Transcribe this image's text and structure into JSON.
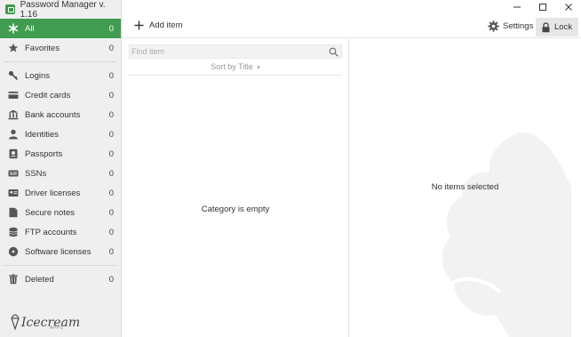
{
  "app": {
    "title": "Password Manager v. 1.16"
  },
  "window_controls": {
    "minimize": "—",
    "maximize": "☐",
    "close": "✕"
  },
  "sidebar": {
    "items": [
      {
        "key": "all",
        "label": "All",
        "count": "0",
        "icon": "asterisk-icon",
        "active": true
      },
      {
        "key": "favorites",
        "label": "Favorites",
        "count": "0",
        "icon": "star-icon"
      },
      {
        "key": "logins",
        "label": "Logins",
        "count": "0",
        "icon": "key-icon"
      },
      {
        "key": "credit-cards",
        "label": "Credit cards",
        "count": "0",
        "icon": "credit-card-icon"
      },
      {
        "key": "bank-accounts",
        "label": "Bank accounts",
        "count": "0",
        "icon": "bank-icon"
      },
      {
        "key": "identities",
        "label": "Identities",
        "count": "0",
        "icon": "person-icon"
      },
      {
        "key": "passports",
        "label": "Passports",
        "count": "0",
        "icon": "passport-icon"
      },
      {
        "key": "ssns",
        "label": "SSNs",
        "count": "0",
        "icon": "ssn-card-icon"
      },
      {
        "key": "driver-licenses",
        "label": "Driver licenses",
        "count": "0",
        "icon": "license-icon"
      },
      {
        "key": "secure-notes",
        "label": "Secure notes",
        "count": "0",
        "icon": "note-icon"
      },
      {
        "key": "ftp-accounts",
        "label": "FTP accounts",
        "count": "0",
        "icon": "database-icon"
      },
      {
        "key": "software-licenses",
        "label": "Software licenses",
        "count": "0",
        "icon": "disc-icon"
      },
      {
        "key": "deleted",
        "label": "Deleted",
        "count": "0",
        "icon": "trash-icon"
      }
    ],
    "brand": {
      "name": "Icecream",
      "sub": "APPS"
    }
  },
  "toolbar": {
    "add_label": "Add item",
    "settings_label": "Settings",
    "lock_label": "Lock"
  },
  "list": {
    "search_placeholder": "Find item",
    "sort_label": "Sort by Title",
    "empty_text": "Category is empty"
  },
  "detail": {
    "empty_text": "No items selected"
  },
  "colors": {
    "accent": "#3f9c50",
    "sidebar_bg": "#efefef"
  }
}
